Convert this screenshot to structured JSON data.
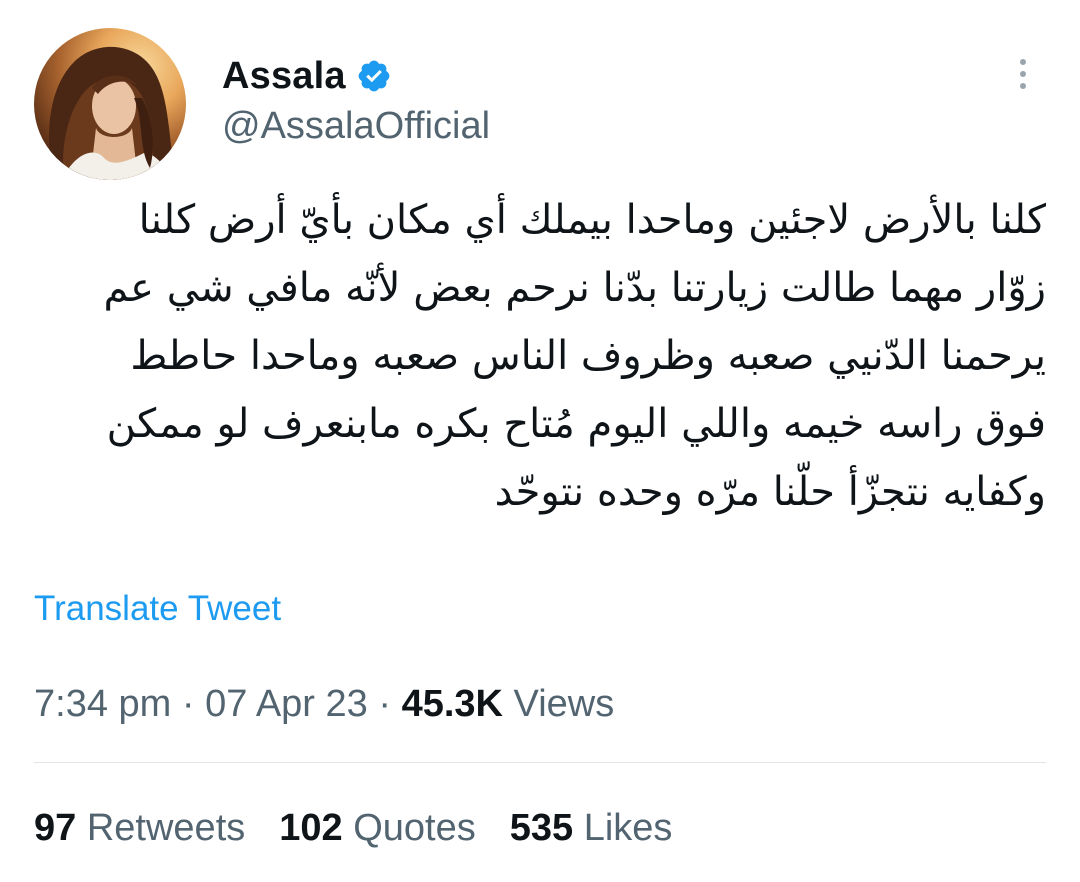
{
  "author": {
    "name": "Assala",
    "handle": "@AssalaOfficial",
    "verified": true,
    "verified_badge_color": "#1d9bf0"
  },
  "tweet": {
    "lines": [
      "كلنا بالأرض لاجئين وماحدا بيملك أي مكان بأيّ أرض كلنا",
      "زوّار مهما طالت زيارتنا بدّنا نرحم بعض لأنّه مافي شي عم",
      "يرحمنا الدّنيي صعبه وظروف الناس صعبه وماحدا حاطط",
      "فوق راسه خيمه واللي اليوم مُتاح بكره مابنعرف لو ممكن",
      "وكفايه نتجزّأ حلّنا مرّه وحده نتوحّد"
    ],
    "translate_label": "Translate Tweet"
  },
  "meta": {
    "time": "7:34 pm",
    "separator": "·",
    "date": "07 Apr 23",
    "views_count": "45.3K",
    "views_label": "Views"
  },
  "stats": {
    "retweets_count": "97",
    "retweets_label": "Retweets",
    "quotes_count": "102",
    "quotes_label": "Quotes",
    "likes_count": "535",
    "likes_label": "Likes"
  },
  "colors": {
    "link": "#1d9bf0",
    "secondary_text": "#536471",
    "primary_text": "#0f1419"
  },
  "icons": {
    "verified": "verified-badge-icon",
    "more": "more-options-icon"
  }
}
